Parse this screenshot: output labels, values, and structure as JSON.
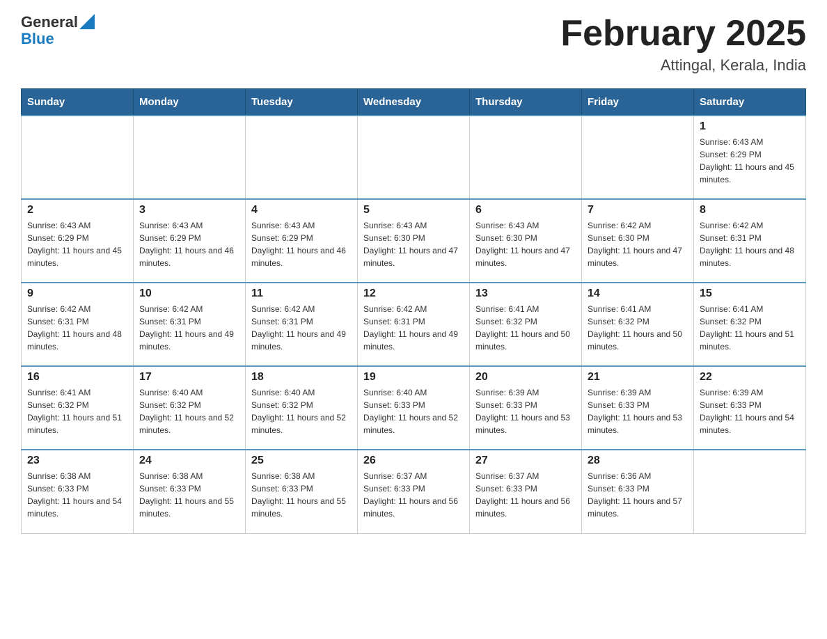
{
  "header": {
    "logo_general": "General",
    "logo_blue": "Blue",
    "title": "February 2025",
    "subtitle": "Attingal, Kerala, India"
  },
  "weekdays": [
    "Sunday",
    "Monday",
    "Tuesday",
    "Wednesday",
    "Thursday",
    "Friday",
    "Saturday"
  ],
  "weeks": [
    [
      {
        "day": "",
        "sunrise": "",
        "sunset": "",
        "daylight": "",
        "empty": true
      },
      {
        "day": "",
        "sunrise": "",
        "sunset": "",
        "daylight": "",
        "empty": true
      },
      {
        "day": "",
        "sunrise": "",
        "sunset": "",
        "daylight": "",
        "empty": true
      },
      {
        "day": "",
        "sunrise": "",
        "sunset": "",
        "daylight": "",
        "empty": true
      },
      {
        "day": "",
        "sunrise": "",
        "sunset": "",
        "daylight": "",
        "empty": true
      },
      {
        "day": "",
        "sunrise": "",
        "sunset": "",
        "daylight": "",
        "empty": true
      },
      {
        "day": "1",
        "sunrise": "Sunrise: 6:43 AM",
        "sunset": "Sunset: 6:29 PM",
        "daylight": "Daylight: 11 hours and 45 minutes.",
        "empty": false
      }
    ],
    [
      {
        "day": "2",
        "sunrise": "Sunrise: 6:43 AM",
        "sunset": "Sunset: 6:29 PM",
        "daylight": "Daylight: 11 hours and 45 minutes.",
        "empty": false
      },
      {
        "day": "3",
        "sunrise": "Sunrise: 6:43 AM",
        "sunset": "Sunset: 6:29 PM",
        "daylight": "Daylight: 11 hours and 46 minutes.",
        "empty": false
      },
      {
        "day": "4",
        "sunrise": "Sunrise: 6:43 AM",
        "sunset": "Sunset: 6:29 PM",
        "daylight": "Daylight: 11 hours and 46 minutes.",
        "empty": false
      },
      {
        "day": "5",
        "sunrise": "Sunrise: 6:43 AM",
        "sunset": "Sunset: 6:30 PM",
        "daylight": "Daylight: 11 hours and 47 minutes.",
        "empty": false
      },
      {
        "day": "6",
        "sunrise": "Sunrise: 6:43 AM",
        "sunset": "Sunset: 6:30 PM",
        "daylight": "Daylight: 11 hours and 47 minutes.",
        "empty": false
      },
      {
        "day": "7",
        "sunrise": "Sunrise: 6:42 AM",
        "sunset": "Sunset: 6:30 PM",
        "daylight": "Daylight: 11 hours and 47 minutes.",
        "empty": false
      },
      {
        "day": "8",
        "sunrise": "Sunrise: 6:42 AM",
        "sunset": "Sunset: 6:31 PM",
        "daylight": "Daylight: 11 hours and 48 minutes.",
        "empty": false
      }
    ],
    [
      {
        "day": "9",
        "sunrise": "Sunrise: 6:42 AM",
        "sunset": "Sunset: 6:31 PM",
        "daylight": "Daylight: 11 hours and 48 minutes.",
        "empty": false
      },
      {
        "day": "10",
        "sunrise": "Sunrise: 6:42 AM",
        "sunset": "Sunset: 6:31 PM",
        "daylight": "Daylight: 11 hours and 49 minutes.",
        "empty": false
      },
      {
        "day": "11",
        "sunrise": "Sunrise: 6:42 AM",
        "sunset": "Sunset: 6:31 PM",
        "daylight": "Daylight: 11 hours and 49 minutes.",
        "empty": false
      },
      {
        "day": "12",
        "sunrise": "Sunrise: 6:42 AM",
        "sunset": "Sunset: 6:31 PM",
        "daylight": "Daylight: 11 hours and 49 minutes.",
        "empty": false
      },
      {
        "day": "13",
        "sunrise": "Sunrise: 6:41 AM",
        "sunset": "Sunset: 6:32 PM",
        "daylight": "Daylight: 11 hours and 50 minutes.",
        "empty": false
      },
      {
        "day": "14",
        "sunrise": "Sunrise: 6:41 AM",
        "sunset": "Sunset: 6:32 PM",
        "daylight": "Daylight: 11 hours and 50 minutes.",
        "empty": false
      },
      {
        "day": "15",
        "sunrise": "Sunrise: 6:41 AM",
        "sunset": "Sunset: 6:32 PM",
        "daylight": "Daylight: 11 hours and 51 minutes.",
        "empty": false
      }
    ],
    [
      {
        "day": "16",
        "sunrise": "Sunrise: 6:41 AM",
        "sunset": "Sunset: 6:32 PM",
        "daylight": "Daylight: 11 hours and 51 minutes.",
        "empty": false
      },
      {
        "day": "17",
        "sunrise": "Sunrise: 6:40 AM",
        "sunset": "Sunset: 6:32 PM",
        "daylight": "Daylight: 11 hours and 52 minutes.",
        "empty": false
      },
      {
        "day": "18",
        "sunrise": "Sunrise: 6:40 AM",
        "sunset": "Sunset: 6:32 PM",
        "daylight": "Daylight: 11 hours and 52 minutes.",
        "empty": false
      },
      {
        "day": "19",
        "sunrise": "Sunrise: 6:40 AM",
        "sunset": "Sunset: 6:33 PM",
        "daylight": "Daylight: 11 hours and 52 minutes.",
        "empty": false
      },
      {
        "day": "20",
        "sunrise": "Sunrise: 6:39 AM",
        "sunset": "Sunset: 6:33 PM",
        "daylight": "Daylight: 11 hours and 53 minutes.",
        "empty": false
      },
      {
        "day": "21",
        "sunrise": "Sunrise: 6:39 AM",
        "sunset": "Sunset: 6:33 PM",
        "daylight": "Daylight: 11 hours and 53 minutes.",
        "empty": false
      },
      {
        "day": "22",
        "sunrise": "Sunrise: 6:39 AM",
        "sunset": "Sunset: 6:33 PM",
        "daylight": "Daylight: 11 hours and 54 minutes.",
        "empty": false
      }
    ],
    [
      {
        "day": "23",
        "sunrise": "Sunrise: 6:38 AM",
        "sunset": "Sunset: 6:33 PM",
        "daylight": "Daylight: 11 hours and 54 minutes.",
        "empty": false
      },
      {
        "day": "24",
        "sunrise": "Sunrise: 6:38 AM",
        "sunset": "Sunset: 6:33 PM",
        "daylight": "Daylight: 11 hours and 55 minutes.",
        "empty": false
      },
      {
        "day": "25",
        "sunrise": "Sunrise: 6:38 AM",
        "sunset": "Sunset: 6:33 PM",
        "daylight": "Daylight: 11 hours and 55 minutes.",
        "empty": false
      },
      {
        "day": "26",
        "sunrise": "Sunrise: 6:37 AM",
        "sunset": "Sunset: 6:33 PM",
        "daylight": "Daylight: 11 hours and 56 minutes.",
        "empty": false
      },
      {
        "day": "27",
        "sunrise": "Sunrise: 6:37 AM",
        "sunset": "Sunset: 6:33 PM",
        "daylight": "Daylight: 11 hours and 56 minutes.",
        "empty": false
      },
      {
        "day": "28",
        "sunrise": "Sunrise: 6:36 AM",
        "sunset": "Sunset: 6:33 PM",
        "daylight": "Daylight: 11 hours and 57 minutes.",
        "empty": false
      },
      {
        "day": "",
        "sunrise": "",
        "sunset": "",
        "daylight": "",
        "empty": true
      }
    ]
  ]
}
